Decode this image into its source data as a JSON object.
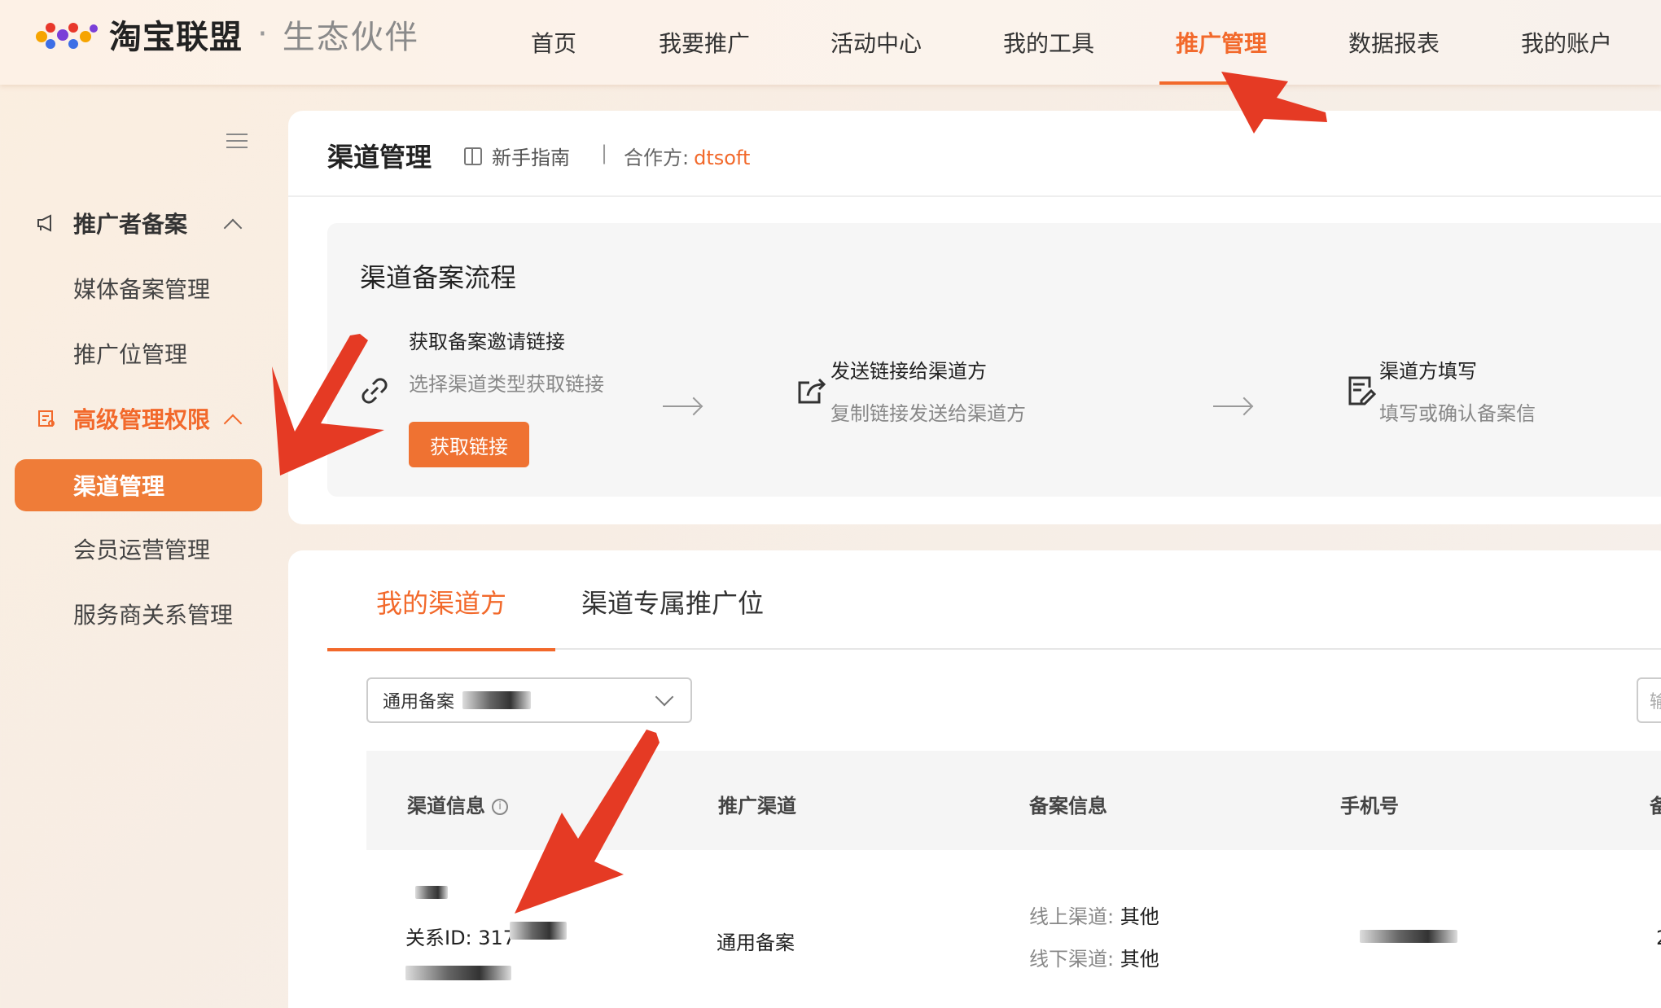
{
  "header": {
    "logo_text": "淘宝联盟",
    "logo_separator": "·",
    "logo_sub": "生态伙伴",
    "nav": [
      {
        "label": "首页",
        "active": false
      },
      {
        "label": "我要推广",
        "active": false
      },
      {
        "label": "活动中心",
        "active": false
      },
      {
        "label": "我的工具",
        "active": false
      },
      {
        "label": "推广管理",
        "active": true
      },
      {
        "label": "数据报表",
        "active": false
      },
      {
        "label": "我的账户",
        "active": false
      }
    ]
  },
  "sidebar": {
    "toggle_icon": "menu-icon",
    "groups": [
      {
        "label": "推广者备案",
        "icon": "megaphone-icon",
        "expanded": true,
        "items": [
          "媒体备案管理",
          "推广位管理"
        ]
      },
      {
        "label": "高级管理权限",
        "icon": "admin-icon",
        "expanded": true,
        "items": [
          "渠道管理",
          "会员运营管理",
          "服务商关系管理"
        ]
      }
    ],
    "active_item": "渠道管理"
  },
  "page": {
    "title": "渠道管理",
    "guide_label": "新手指南",
    "separator": "|",
    "partner_label": "合作方:",
    "partner_value": "dtsoft"
  },
  "flow": {
    "title": "渠道备案流程",
    "steps": [
      {
        "icon": "link-icon",
        "title": "获取备案邀请链接",
        "desc": "选择渠道类型获取链接",
        "button": "获取链接"
      },
      {
        "icon": "share-icon",
        "title": "发送链接给渠道方",
        "desc": "复制链接发送给渠道方"
      },
      {
        "icon": "form-edit-icon",
        "title": "渠道方填写",
        "desc": "填写或确认备案信"
      }
    ]
  },
  "tabs": [
    {
      "label": "我的渠道方",
      "active": true
    },
    {
      "label": "渠道专属推广位",
      "active": false
    }
  ],
  "filter": {
    "select_value": "通用备案",
    "search_partial": "输"
  },
  "table": {
    "headers": [
      "渠道信息",
      "推广渠道",
      "备案信息",
      "手机号",
      "备"
    ],
    "rows": [
      {
        "relation_id": "关系ID: 317",
        "channel": "通用备案",
        "online_label": "线上渠道:",
        "online_value": "其他",
        "offline_label": "线下渠道:",
        "offline_value": "其他",
        "last_col": "2"
      }
    ]
  },
  "colors": {
    "accent": "#f2692b",
    "active_menu_bg": "#ef7c38",
    "annotation_red": "#e53a24"
  }
}
